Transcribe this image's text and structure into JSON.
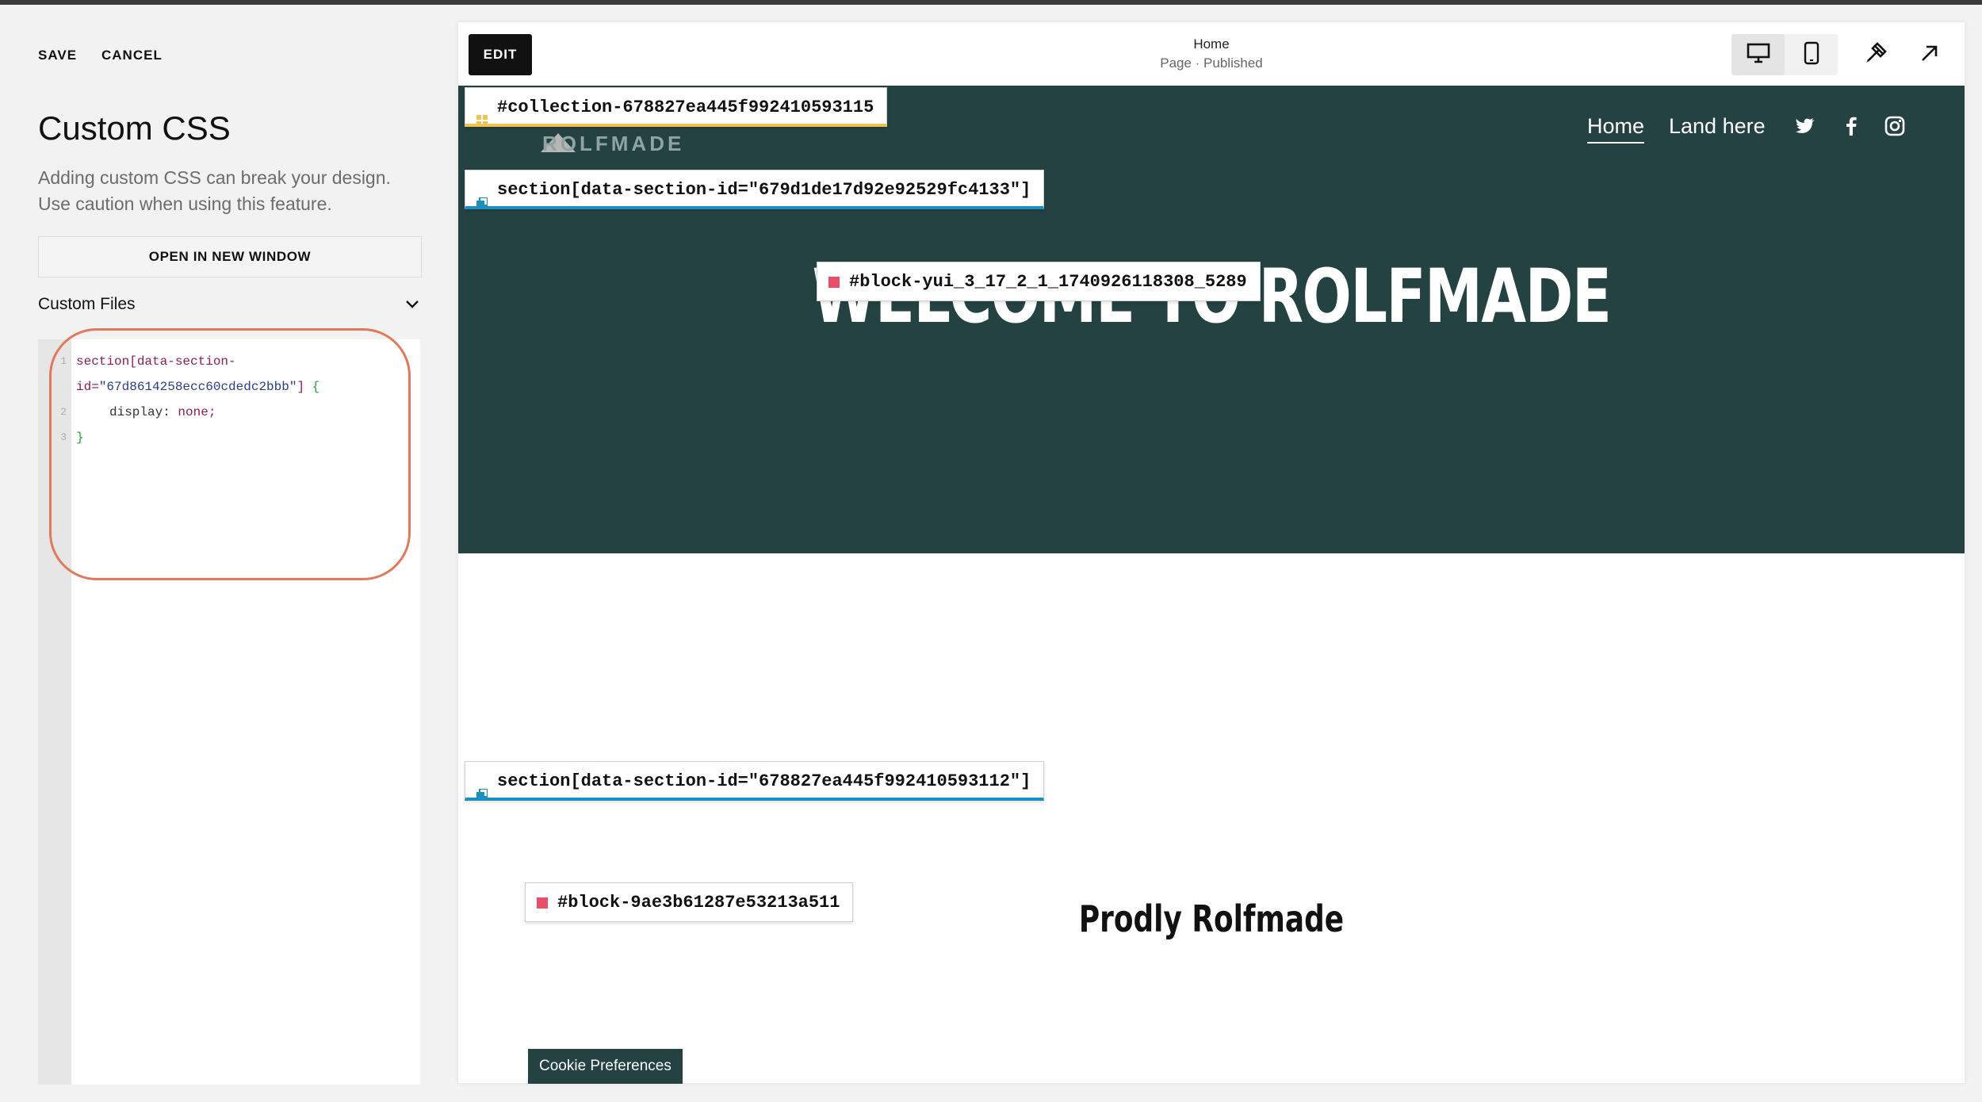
{
  "panel": {
    "save_label": "SAVE",
    "cancel_label": "CANCEL",
    "title": "Custom CSS",
    "description": "Adding custom CSS can break your design. Use caution when using this feature.",
    "open_window_label": "OPEN IN NEW WINDOW",
    "custom_files_label": "Custom Files",
    "code": {
      "line1_num": "1",
      "line1a": "section[data-section-",
      "line1b_pre": "id=",
      "line1b_str": "\"67d8614258ecc60cdedc2bbb\"",
      "line1b_post": "] ",
      "brace_open": "{",
      "line2_num": "2",
      "line2_prop": "display: ",
      "line2_val": "none;",
      "line3_num": "3",
      "brace_close": "}"
    }
  },
  "preview": {
    "edit_label": "EDIT",
    "page_name": "Home",
    "page_status": "Page · Published",
    "logo_fragment": "ROLFMADE",
    "nav": {
      "home": "Home",
      "land": "Land here"
    },
    "hero_title": "WELCOME TO ROLFMADE",
    "subtitle": "Prodly Rolfmade",
    "cookie_label": "Cookie Preferences",
    "tags": {
      "collection": "#collection-678827ea445f992410593115",
      "section1": "section[data-section-id=\"679d1de17d92e92529fc4133\"]",
      "block1": "#block-yui_3_17_2_1_1740926118308_5289",
      "section2": "section[data-section-id=\"678827ea445f992410593112\"]",
      "block2": "#block-9ae3b61287e53213a511"
    }
  },
  "colors": {
    "hero_bg": "#254242",
    "highlight": "#e07a5a",
    "collection_tag": "#f2c14e",
    "section_tag": "#1b8fc0",
    "block_tag": "#e8506a"
  },
  "icons": [
    "desktop-icon",
    "mobile-icon",
    "paintbrush-icon",
    "external-link-icon",
    "twitter-icon",
    "facebook-icon",
    "instagram-icon",
    "chevron-down-icon"
  ]
}
